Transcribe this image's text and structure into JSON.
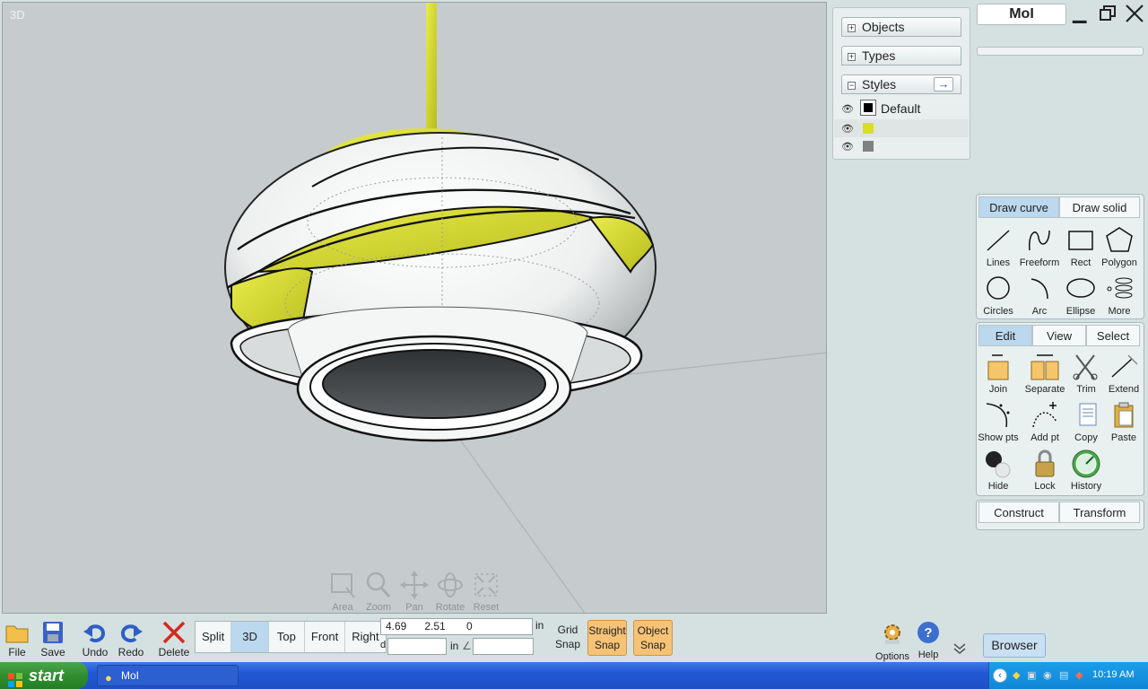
{
  "viewport": {
    "label": "3D"
  },
  "nav_controls": [
    {
      "label": "Area",
      "icon": "area-zoom-icon"
    },
    {
      "label": "Zoom",
      "icon": "zoom-icon"
    },
    {
      "label": "Pan",
      "icon": "pan-icon"
    },
    {
      "label": "Rotate",
      "icon": "rotate-icon"
    },
    {
      "label": "Reset",
      "icon": "reset-view-icon"
    }
  ],
  "scene_browser": {
    "objects": "Objects",
    "types": "Types",
    "styles": "Styles",
    "style_rows": [
      {
        "name": "Default",
        "color": "#000000"
      },
      {
        "name": "",
        "color": "#d8dc2e"
      },
      {
        "name": "",
        "color": "#808080"
      }
    ]
  },
  "app_window": {
    "title": "MoI"
  },
  "palette": {
    "draw_tabs": [
      "Draw curve",
      "Draw solid"
    ],
    "draw_commands": [
      "Lines",
      "Freeform",
      "Rect",
      "Polygon",
      "Circles",
      "Arc",
      "Ellipse",
      "More"
    ],
    "edit_tabs": [
      "Edit",
      "View",
      "Select"
    ],
    "edit_commands": [
      "Join",
      "Separate",
      "Trim",
      "Extend",
      "Show pts",
      "Add pt",
      "Copy",
      "Paste",
      "Hide",
      "Lock",
      "History"
    ],
    "bottom_tabs": [
      "Construct",
      "Transform"
    ]
  },
  "toolbar": {
    "file": "File",
    "save": "Save",
    "undo": "Undo",
    "redo": "Redo",
    "delete": "Delete",
    "view_buttons": [
      "Split",
      "3D",
      "Top",
      "Front",
      "Right"
    ],
    "coords": "4.69      2.51       0",
    "coord_unit": "in",
    "distance_label": "d",
    "distance_unit": "in",
    "angle_label": "∠",
    "grid_snap": [
      "Grid",
      "Snap"
    ],
    "straight_snap": [
      "Straight",
      "Snap"
    ],
    "object_snap": [
      "Object",
      "Snap"
    ],
    "options": "Options",
    "help": "Help",
    "browser": "Browser"
  },
  "taskbar": {
    "start": "start",
    "task": "MoI",
    "clock": "10:19 AM"
  },
  "colors": {
    "accent_tab": "#bcd8ee",
    "snap_on": "#f6c275",
    "lime": "#d8dc2e"
  }
}
